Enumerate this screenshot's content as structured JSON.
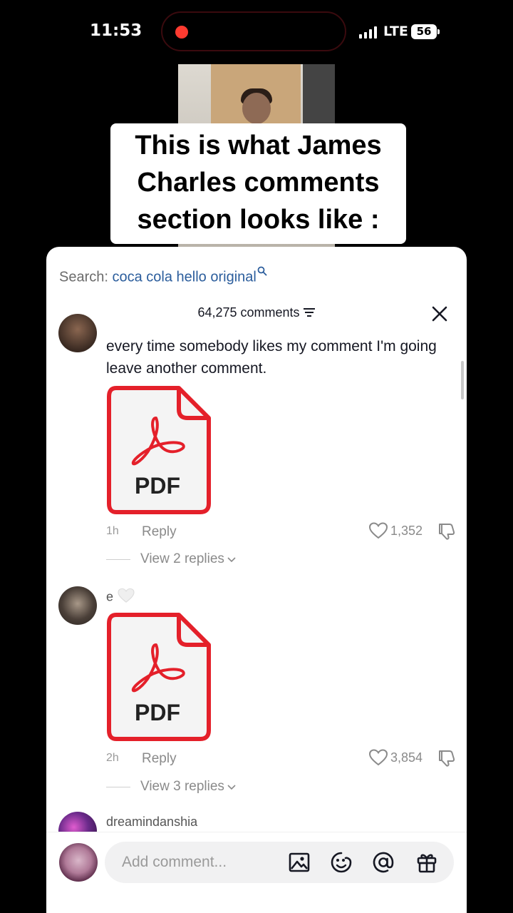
{
  "status_bar": {
    "time": "11:53",
    "network": "LTE",
    "battery": "56"
  },
  "caption": {
    "line1": "This is what James",
    "line2": "Charles comments",
    "line3": "section looks like :"
  },
  "search": {
    "label": "Search: ",
    "query": "coca cola hello original"
  },
  "comments_count": "64,275 comments",
  "comments": [
    {
      "text": "every time somebody likes my comment I'm going leave another comment.",
      "attachment": "PDF",
      "age": "1h",
      "reply_label": "Reply",
      "likes": "1,352",
      "view_replies": "View 2 replies"
    },
    {
      "username": "e",
      "attachment": "PDF",
      "age": "2h",
      "reply_label": "Reply",
      "likes": "3,854",
      "view_replies": "View 3 replies"
    },
    {
      "username": "dreamindanshia"
    }
  ],
  "input": {
    "placeholder": "Add comment..."
  },
  "colors": {
    "pdf_red": "#e4202a",
    "link_blue": "#2b5d9c",
    "sheet_bg": "#ffffff"
  },
  "icons": [
    "record-dot-icon",
    "signal-icon",
    "battery-icon",
    "search-icon",
    "filter-icon",
    "close-icon",
    "pdf-icon",
    "heart-icon",
    "dislike-icon",
    "chevron-down-icon",
    "image-icon",
    "emoji-icon",
    "at-icon",
    "gift-icon"
  ]
}
